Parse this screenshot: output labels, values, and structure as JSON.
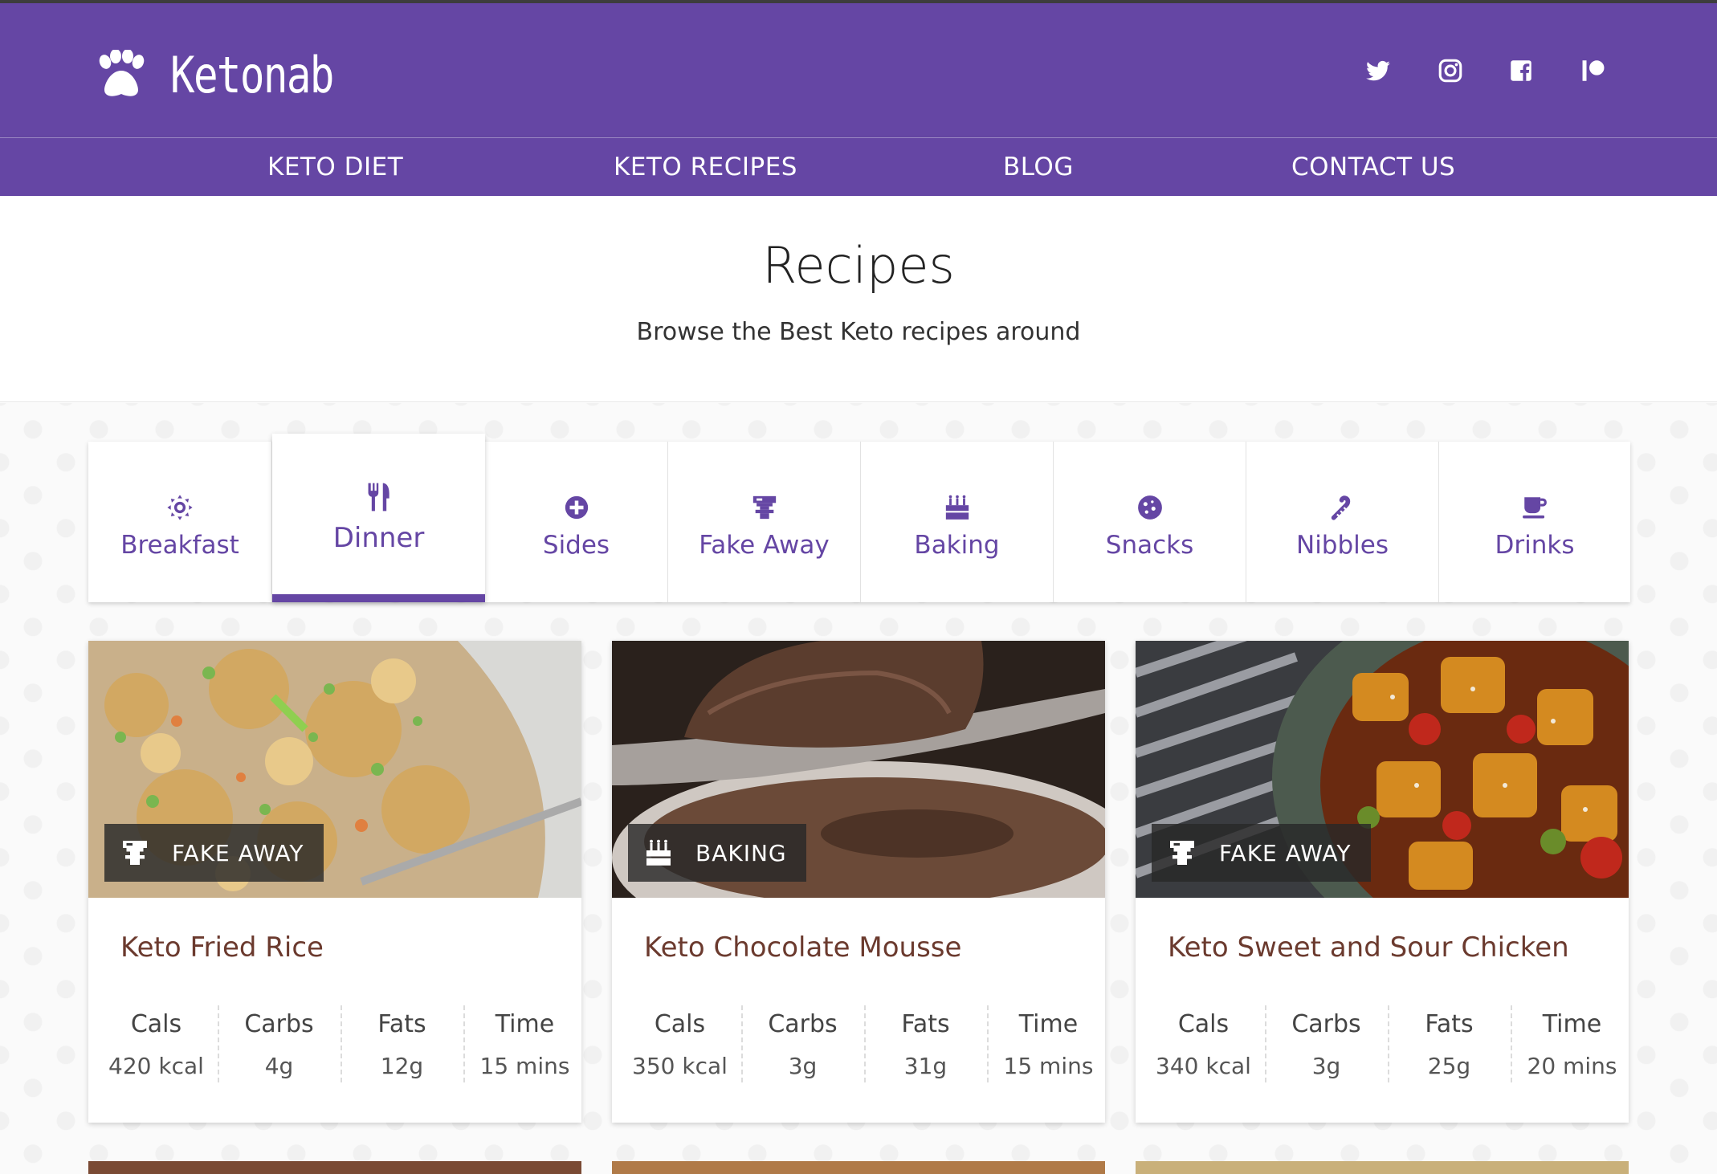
{
  "brand": {
    "name": "Ketonab",
    "icon": "paw-icon"
  },
  "social": [
    {
      "name": "twitter-icon"
    },
    {
      "name": "instagram-icon"
    },
    {
      "name": "facebook-icon"
    },
    {
      "name": "patreon-icon"
    }
  ],
  "nav": [
    "KETO DIET",
    "KETO RECIPES",
    "BLOG",
    "CONTACT US"
  ],
  "hero": {
    "title": "Recipes",
    "subtitle": "Browse the Best Keto recipes around"
  },
  "tabs": [
    {
      "label": "Breakfast",
      "icon": "sun-icon"
    },
    {
      "label": "Dinner",
      "icon": "utensils-icon",
      "active": true
    },
    {
      "label": "Sides",
      "icon": "plus-circle-icon"
    },
    {
      "label": "Fake Away",
      "icon": "takeaway-icon"
    },
    {
      "label": "Baking",
      "icon": "birthday-cake-icon"
    },
    {
      "label": "Snacks",
      "icon": "cookie-icon"
    },
    {
      "label": "Nibbles",
      "icon": "candy-cane-icon"
    },
    {
      "label": "Drinks",
      "icon": "coffee-cup-icon"
    }
  ],
  "colors": {
    "brand": "#6546a4",
    "title": "#6b3a2e"
  },
  "stat_labels": [
    "Cals",
    "Carbs",
    "Fats",
    "Time"
  ],
  "recipes": [
    {
      "title": "Keto Fried Rice",
      "category": "FAKE AWAY",
      "category_icon": "takeaway-icon",
      "cals": "420 kcal",
      "carbs": "4g",
      "fats": "12g",
      "time": "15 mins"
    },
    {
      "title": "Keto Chocolate Mousse",
      "category": "BAKING",
      "category_icon": "birthday-cake-icon",
      "cals": "350 kcal",
      "carbs": "3g",
      "fats": "31g",
      "time": "15 mins"
    },
    {
      "title": "Keto Sweet and Sour Chicken",
      "category": "FAKE AWAY",
      "category_icon": "takeaway-icon",
      "cals": "340 kcal",
      "carbs": "3g",
      "fats": "25g",
      "time": "20 mins"
    }
  ]
}
